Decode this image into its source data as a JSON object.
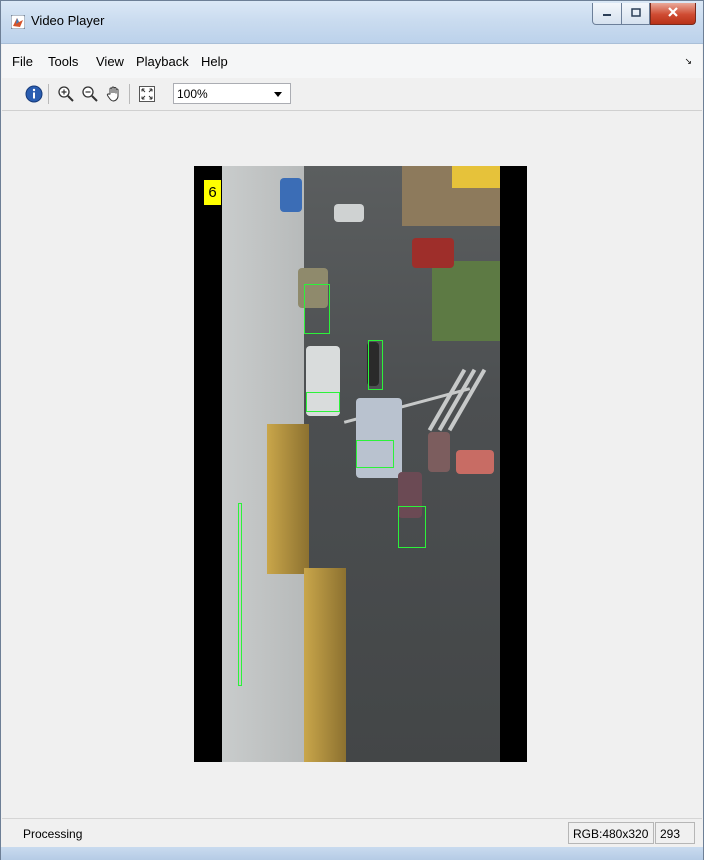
{
  "window": {
    "title": "Video Player",
    "icon": "matlab-icon"
  },
  "menu": {
    "items": [
      "File",
      "Tools",
      "View",
      "Playback",
      "Help"
    ]
  },
  "toolbar": {
    "zoom_value": "100%",
    "icons": [
      "info-icon",
      "zoom-in-icon",
      "zoom-out-icon",
      "pan-hand-icon",
      "fit-to-window-icon"
    ]
  },
  "video": {
    "frame_number": "6"
  },
  "status": {
    "text": "Processing",
    "format": "RGB:480x320",
    "frame": "293"
  }
}
